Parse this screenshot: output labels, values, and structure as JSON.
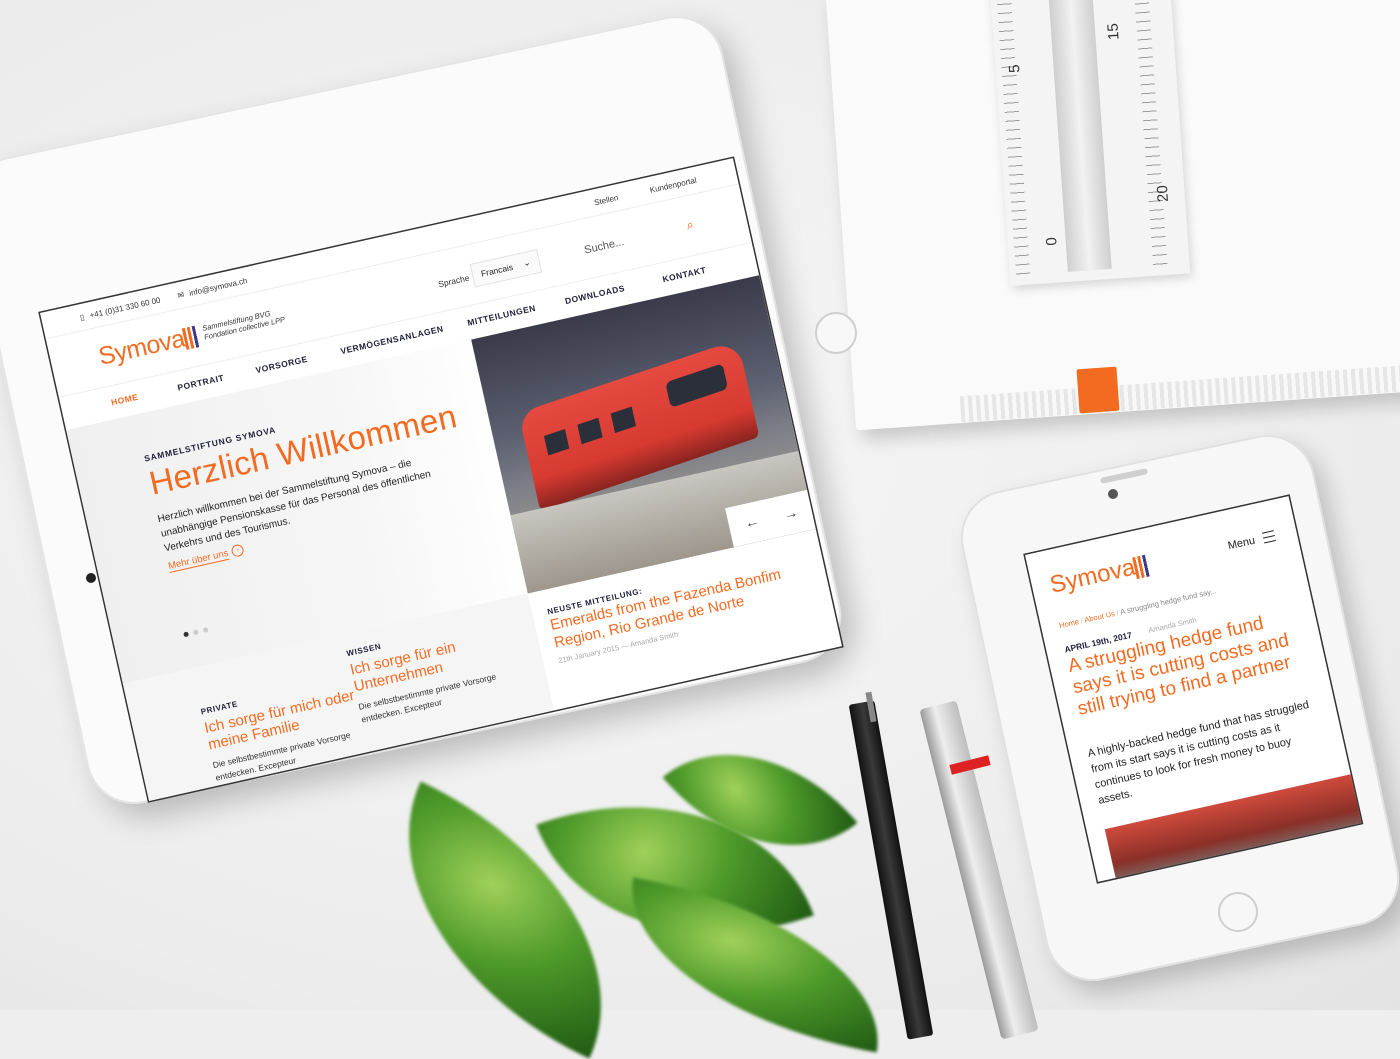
{
  "tablet": {
    "topbar": {
      "phone": "+41 (0)31 330 60 00",
      "email": "info@symova.ch",
      "links": [
        "Stellen",
        "Kundenportal"
      ]
    },
    "brand": {
      "name": "Symova",
      "subtitle_line1": "Sammelstiftung BVG",
      "subtitle_line2": "Fondation collective LPP"
    },
    "language": {
      "label": "Sprache",
      "selected": "Francais"
    },
    "search": {
      "placeholder": "Suche..."
    },
    "nav": [
      "HOME",
      "PORTRAIT",
      "VORSORGE",
      "VERMÖGENSANLAGEN",
      "MITTEILUNGEN",
      "DOWNLOADS",
      "KONTAKT"
    ],
    "hero": {
      "eyebrow": "SAMMELSTIFTUNG SYMOVA",
      "title": "Herzlich Willkommen",
      "text": "Herzlich willkommen bei der Sammelstiftung Symova – die unabhängige Pensionskasse für das Personal des öffentlichen Verkehrs und des Tourismus.",
      "link": "Mehr über uns",
      "prev": "←",
      "next": "→"
    },
    "news": {
      "eyebrow": "NEUSTE MITTEILUNG:",
      "title": "Emeralds from the Fazenda Bonfim Region, Rio Grande de Norte",
      "meta": "21th January 2015 — Amanda Smith"
    },
    "cards": [
      {
        "eyebrow": "PRIVATE",
        "title": "Ich sorge für mich oder meine Familie",
        "text": "Die selbstbestimmte private Vorsorge entdecken. Excepteur"
      },
      {
        "eyebrow": "WISSEN",
        "title": "Ich sorge für ein Unternehmen",
        "text": "Die selbstbestimmte private Vorsorge entdecken. Excepteur"
      }
    ]
  },
  "phone": {
    "brand": "Symova",
    "menu_label": "Menu",
    "breadcrumb": [
      "Home",
      "About Us",
      "A struggling hedge fund say..."
    ],
    "date": "APRIL 19th, 2017",
    "author": "Amanda Smith",
    "title": "A struggling hedge fund says it is cutting costs and still trying to find a partner",
    "text": "A highly-backed hedge fund that has struggled from its start says it is cutting costs as it continues to look for fresh money to buoy assets."
  },
  "ruler": {
    "numbers": [
      "0",
      "5",
      "15",
      "20"
    ]
  },
  "colors": {
    "accent": "#f26b21",
    "navy": "#1f1f3a",
    "bar_blue": "#3b3b8a"
  }
}
